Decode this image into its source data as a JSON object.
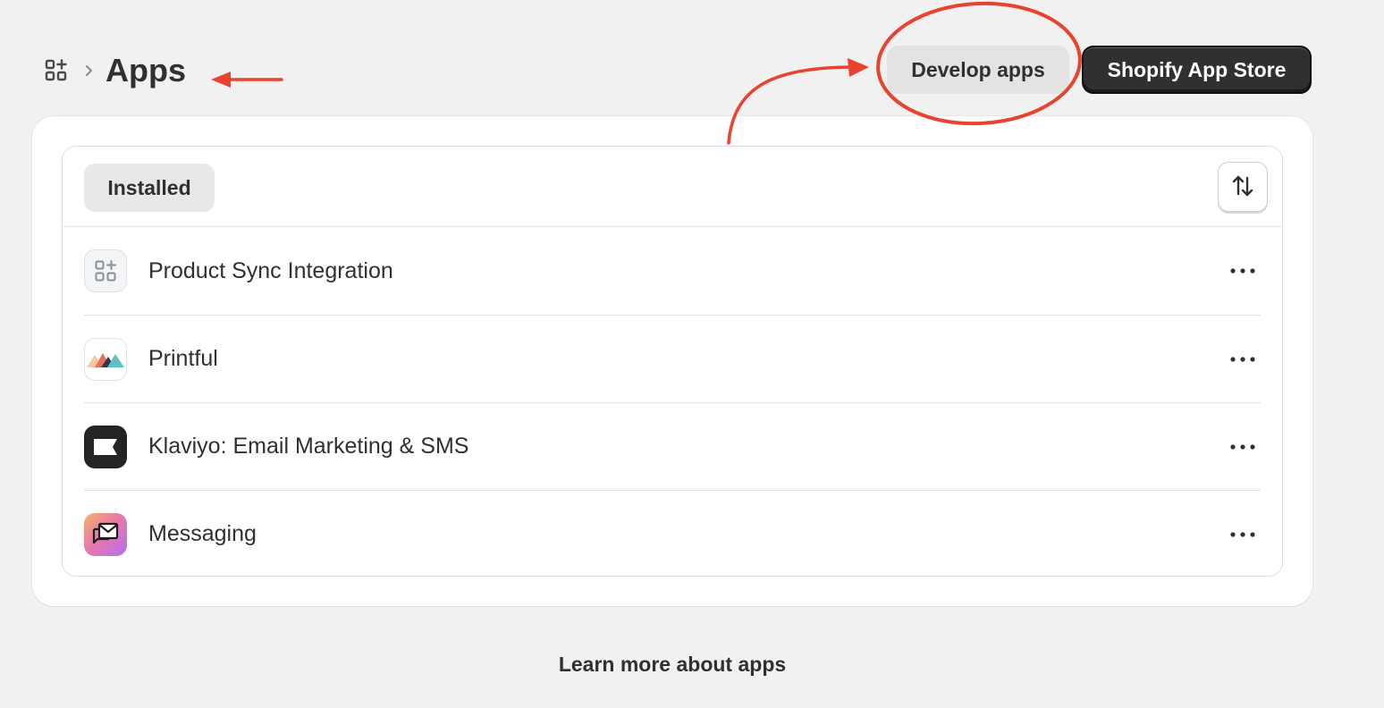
{
  "header": {
    "title": "Apps",
    "develop_label": "Develop apps",
    "store_label": "Shopify App Store"
  },
  "icons": {
    "apps": "apps-grid-icon",
    "breadcrumb": "chevron-right-icon",
    "sort": "sort-arrows-icon",
    "more": "ellipsis-horizontal-icon"
  },
  "tabs": {
    "installed": "Installed"
  },
  "apps": [
    {
      "name": "Product Sync Integration",
      "icon": "generic-app-icon"
    },
    {
      "name": "Printful",
      "icon": "printful-logo-icon"
    },
    {
      "name": "Klaviyo: Email Marketing & SMS",
      "icon": "klaviyo-logo-icon"
    },
    {
      "name": "Messaging",
      "icon": "messaging-logo-icon"
    }
  ],
  "footer": {
    "learn_more": "Learn more about apps"
  },
  "colors": {
    "background": "#f1f1f1",
    "primary_button": "#303030",
    "secondary_button": "#e3e3e3",
    "annotation": "#e8432d"
  }
}
